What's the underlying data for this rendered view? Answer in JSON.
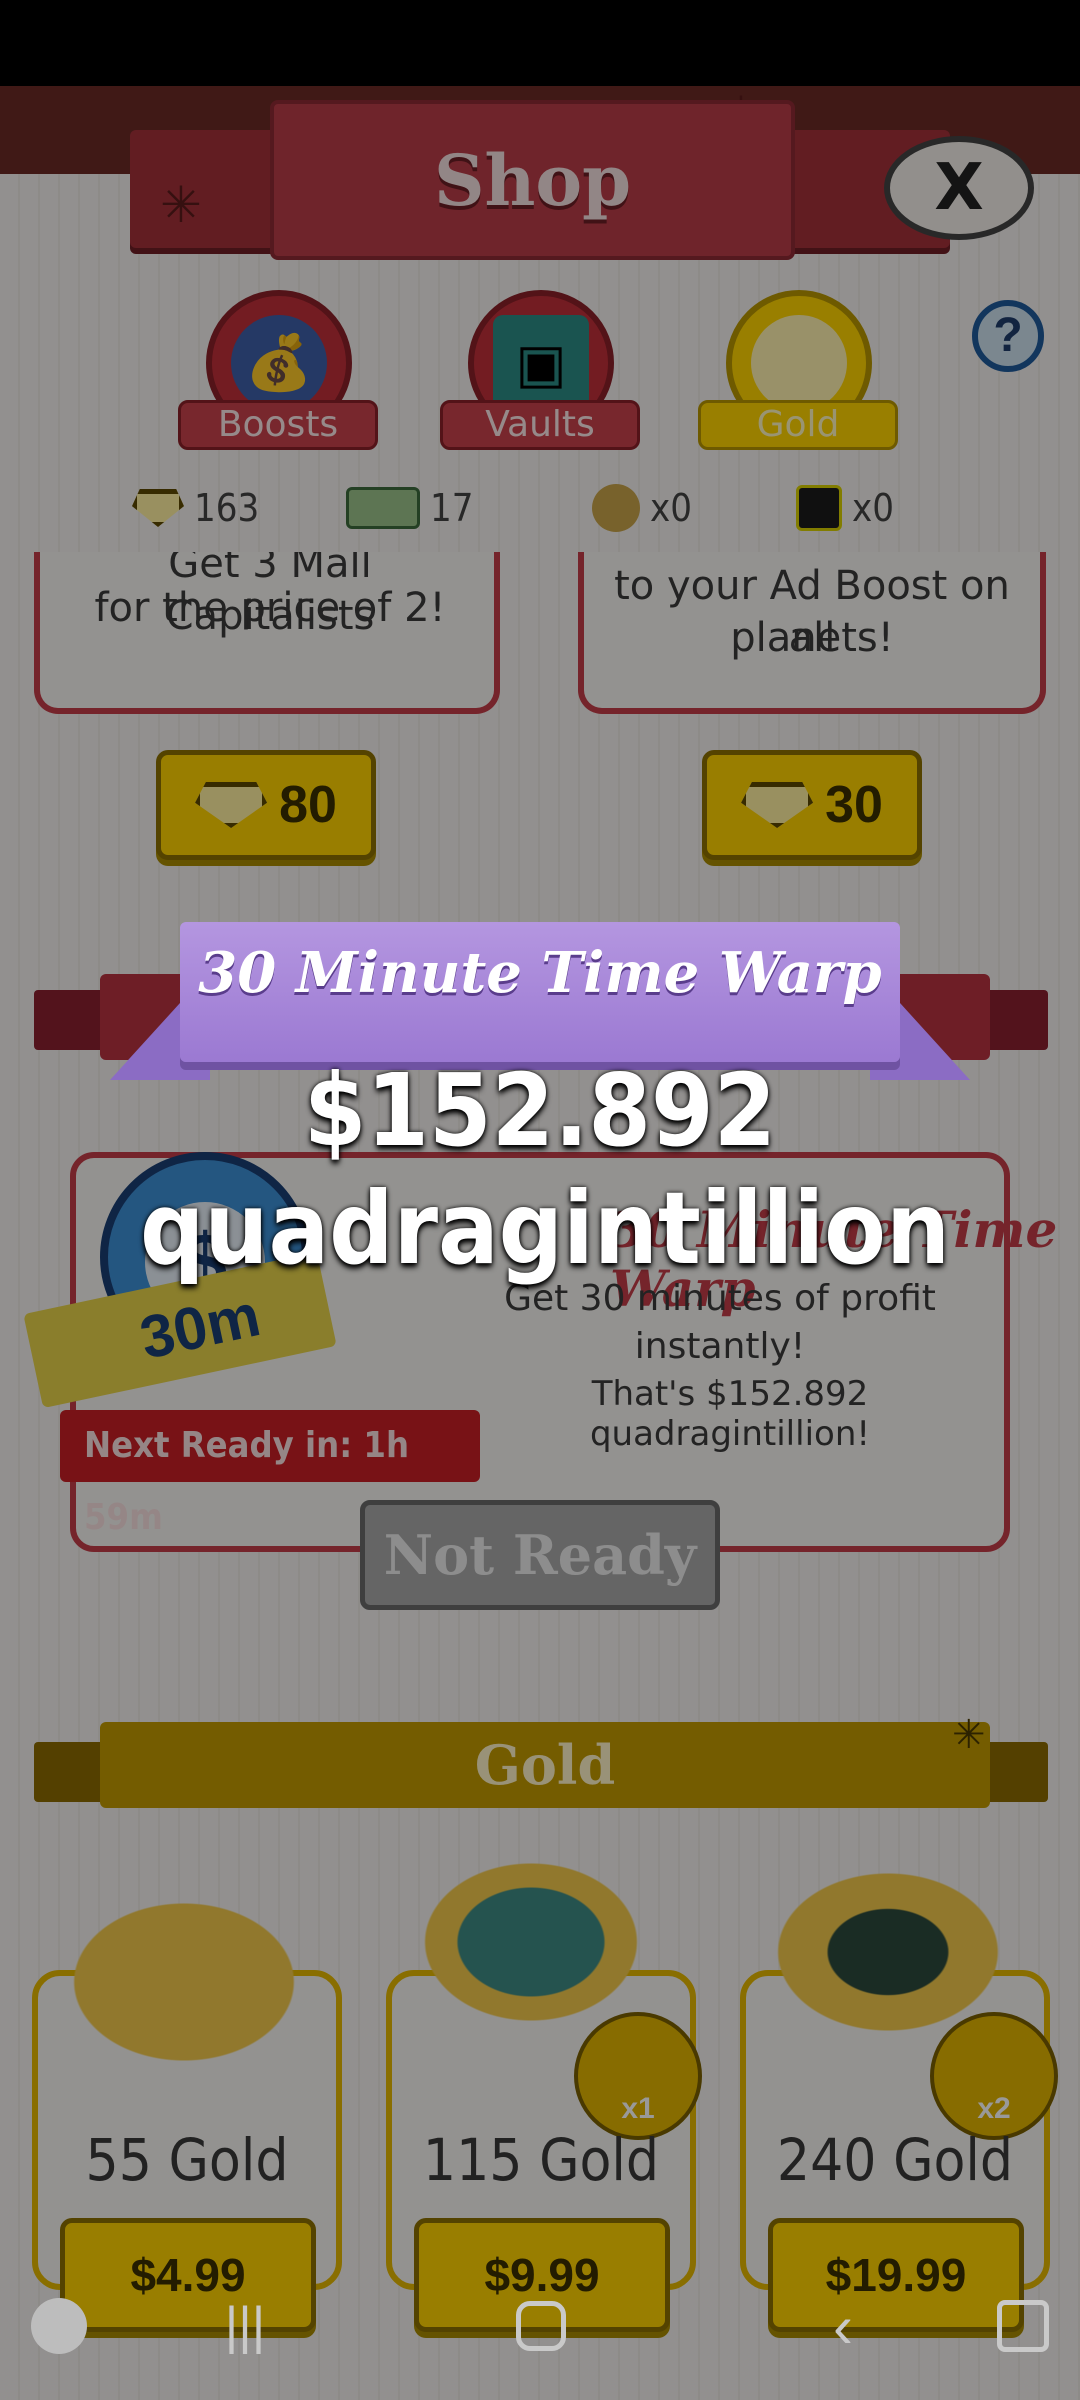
{
  "header": {
    "title": "Shop",
    "close_label": "X"
  },
  "tabs": [
    {
      "label": "Boosts",
      "active": false
    },
    {
      "label": "Vaults",
      "active": false
    },
    {
      "label": "Gold",
      "active": true
    }
  ],
  "help_label": "?",
  "currencies": [
    {
      "icon": "gold-bar-icon",
      "value": "163"
    },
    {
      "icon": "mega-bucks-icon",
      "value": "17"
    },
    {
      "icon": "cash-bag-icon",
      "value": "x0"
    },
    {
      "icon": "mega-ticket-icon",
      "value": "x0"
    }
  ],
  "offers_top": [
    {
      "text": "for the price of 2!",
      "partial": "Get 3 Mall Capitalists",
      "price": "80"
    },
    {
      "text_line1": "to your Ad Boost on all",
      "text_line2": "planets!",
      "price": "30"
    }
  ],
  "free_gift": {
    "item_title": "30 Minute Time Warp",
    "desc_line1": "Get 30 minutes of profit",
    "desc_line2": "instantly!",
    "worth": "That's $152.892 quadragintillion!",
    "badge": "30m",
    "next_ready": "Next Ready in: 1h 59m",
    "button": "Not Ready"
  },
  "gold_section": {
    "title": "Gold",
    "packs": [
      {
        "amount": "55 Gold",
        "price": "$4.99",
        "badge": ""
      },
      {
        "amount": "115 Gold",
        "price": "$9.99",
        "badge": "x1"
      },
      {
        "amount": "240 Gold",
        "price": "$19.99",
        "badge": "x2"
      }
    ]
  },
  "popup": {
    "title": "30 Minute Time Warp",
    "amount_line1": "$152.892",
    "amount_line2": "quadragintillion"
  },
  "colors": {
    "accent_red": "#c33d48",
    "gold": "#ffd200",
    "purple": "#9b79d2"
  }
}
